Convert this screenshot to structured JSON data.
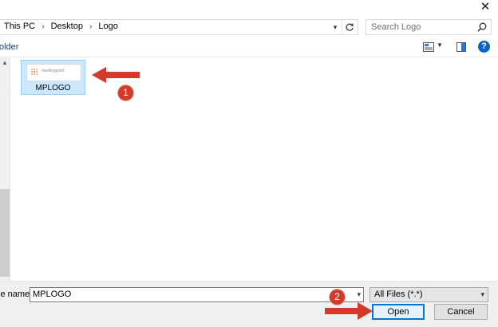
{
  "window": {
    "close_glyph": "✕"
  },
  "address_bar": {
    "crumbs": [
      "This PC",
      "Desktop",
      "Logo"
    ]
  },
  "search": {
    "placeholder": "Search Logo"
  },
  "toolbar": {
    "new_folder_label": "older"
  },
  "help": {
    "glyph": "?"
  },
  "files": [
    {
      "name": "MPLOGO",
      "thumb_text": "meetingpoint"
    }
  ],
  "annotations": {
    "badge_1": "1",
    "badge_2": "2",
    "color": "#d23a2c"
  },
  "bottom": {
    "file_name_label": "le name:",
    "file_name_value": "MPLOGO",
    "filter_value": "All Files (*.*)",
    "open_label": "Open",
    "cancel_label": "Cancel"
  },
  "colors": {
    "selection_bg": "#cce8ff",
    "selection_border": "#99d1ff",
    "accent": "#0078d7",
    "help_blue": "#0a64c8"
  },
  "icons": [
    "close-icon",
    "chevron-down-icon",
    "refresh-icon",
    "search-icon",
    "view-icon",
    "preview-pane-icon",
    "help-icon",
    "scroll-up-icon",
    "arrow-annotation"
  ]
}
